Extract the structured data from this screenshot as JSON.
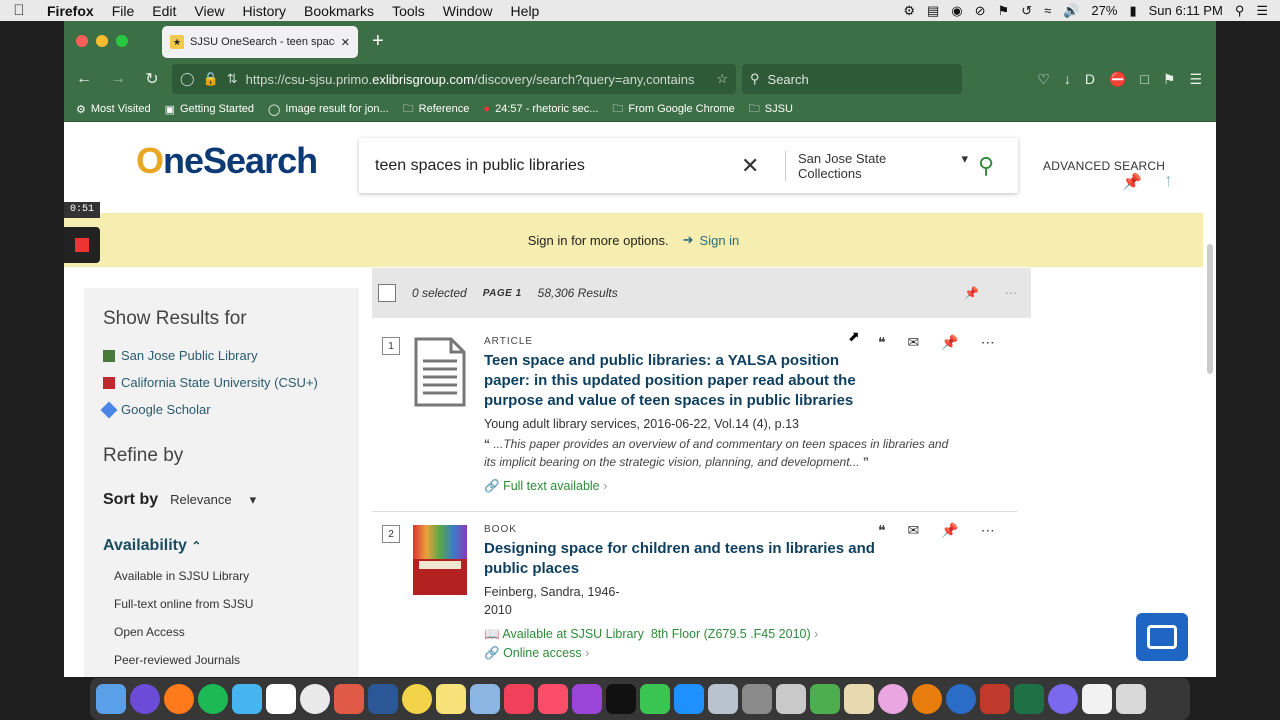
{
  "menubar": {
    "app": "Firefox",
    "items": [
      "File",
      "Edit",
      "View",
      "History",
      "Bookmarks",
      "Tools",
      "Window",
      "Help"
    ],
    "battery": "27%",
    "clock": "Sun 6:11 PM"
  },
  "browser": {
    "tab_title": "SJSU OneSearch - teen spaces",
    "url_prefix": "https://csu-sjsu.primo.",
    "url_host": "exlibrisgroup.com",
    "url_rest": "/discovery/search?query=any,contains",
    "search_placeholder": "Search",
    "avatar_letter": "D",
    "bookmarks": [
      "Most Visited",
      "Getting Started",
      "Image result for jon...",
      "Reference",
      "24:57 - rhetoric sec...",
      "From Google Chrome",
      "SJSU"
    ]
  },
  "overlay": {
    "timer": "0:51"
  },
  "header": {
    "logo_o": "O",
    "logo_rest": "neSearch",
    "query": "teen spaces in public libraries",
    "scope": "San Jose State Collections",
    "advanced": "ADVANCED SEARCH"
  },
  "signin": {
    "message": "Sign in for more options.",
    "button": "Sign in"
  },
  "facets": {
    "show_results_for": "Show Results for",
    "sources": [
      "San Jose Public Library",
      "California State University (CSU+)",
      "Google Scholar"
    ],
    "refine_by": "Refine by",
    "sort_label": "Sort by",
    "sort_value": "Relevance",
    "availability": "Availability",
    "availability_items": [
      "Available in SJSU Library",
      "Full-text online from SJSU",
      "Open Access",
      "Peer-reviewed Journals"
    ]
  },
  "results_bar": {
    "selected": "0 selected",
    "page": "PAGE 1",
    "count": "58,306 Results"
  },
  "results": [
    {
      "num": "1",
      "type": "ARTICLE",
      "title": "Teen space and public libraries: a YALSA position paper: in this updated position paper read about the purpose and value of teen spaces in public libraries",
      "meta": "Young adult library services, 2016-06-22, Vol.14 (4), p.13",
      "snippet": "...This paper provides an overview of and commentary on teen spaces in libraries and its implicit bearing on the strategic vision, planning, and development...",
      "link": "Full text available"
    },
    {
      "num": "2",
      "type": "BOOK",
      "title": "Designing space for children and teens in libraries and public places",
      "meta": "Feinberg, Sandra, 1946-",
      "year": "2010",
      "availability": "Available at SJSU Library",
      "location": "8th Floor (Z679.5 .F45 2010)",
      "link": "Online access"
    }
  ],
  "colors": {
    "browser_chrome": "#3d6f47",
    "signin_banner": "#f5eeb0",
    "link_green": "#2e8b3a",
    "title_blue": "#0e3f5e"
  }
}
